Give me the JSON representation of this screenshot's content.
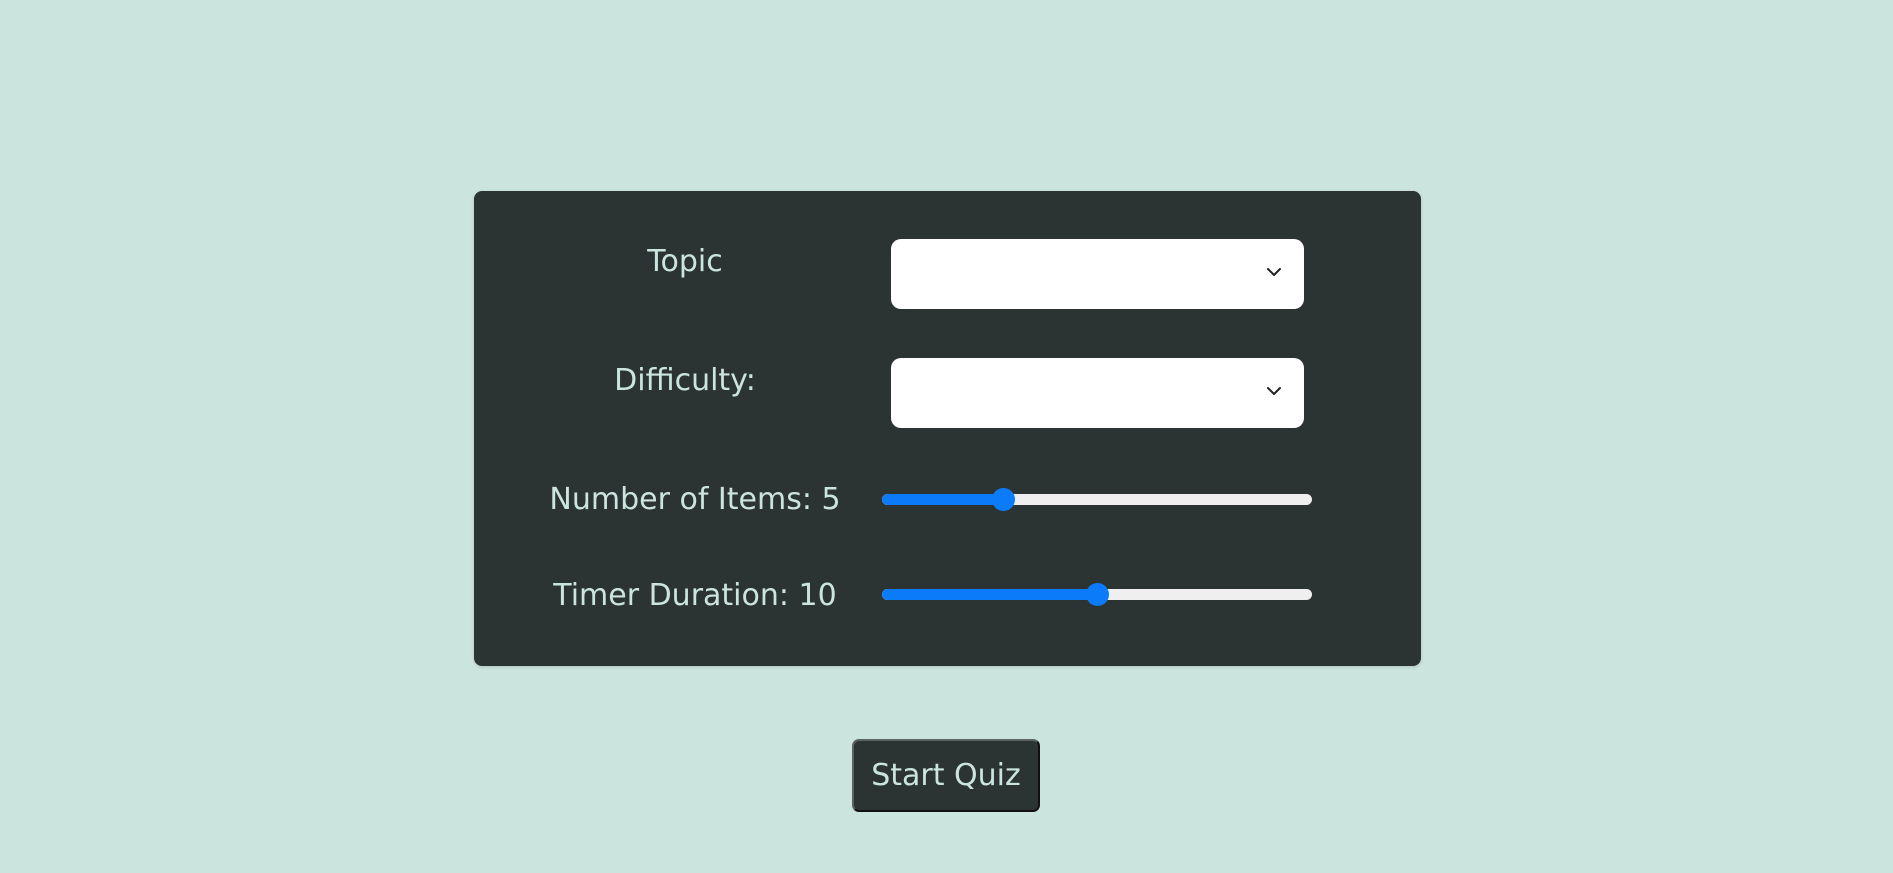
{
  "form": {
    "topic": {
      "label": "Topic",
      "selected": ""
    },
    "difficulty": {
      "label": "Difficulty:",
      "selected": ""
    },
    "items": {
      "label": "Number of Items: 5",
      "value": 5,
      "fraction": 0.27
    },
    "timer": {
      "label": "Timer Duration: 10",
      "value": 10,
      "fraction": 0.5
    }
  },
  "actions": {
    "start_label": "Start Quiz"
  },
  "colors": {
    "background": "#cce4de",
    "panel": "#2c3333",
    "accent": "#0b7bf9",
    "text": "#cce4de"
  },
  "icons": {
    "dropdown": "chevron-down-icon"
  }
}
